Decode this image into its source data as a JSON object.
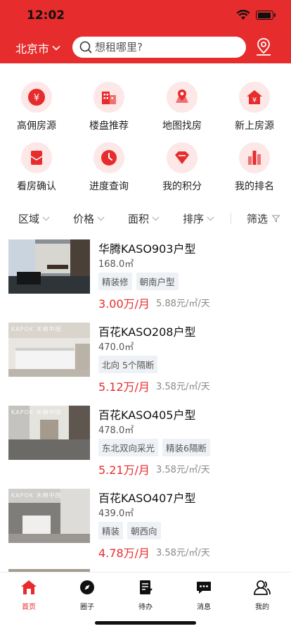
{
  "status": {
    "time": "12:02"
  },
  "header": {
    "city": "北京市",
    "search_placeholder": "想租哪里?"
  },
  "grid": [
    {
      "label": "高佣房源",
      "icon": "yuan-coin-icon"
    },
    {
      "label": "楼盘推荐",
      "icon": "buildings-icon"
    },
    {
      "label": "地图找房",
      "icon": "map-pin-icon"
    },
    {
      "label": "新上房源",
      "icon": "house-yuan-icon"
    },
    {
      "label": "看房确认",
      "icon": "envelope-icon"
    },
    {
      "label": "进度查询",
      "icon": "clock-icon"
    },
    {
      "label": "我的积分",
      "icon": "diamond-icon"
    },
    {
      "label": "我的排名",
      "icon": "bar-chart-icon"
    }
  ],
  "filters": [
    "区域",
    "价格",
    "面积",
    "排序",
    "筛选"
  ],
  "listings": [
    {
      "title": "华腾KASO903户型",
      "area": "168.0㎡",
      "tags": [
        "精装修",
        "朝南户型"
      ],
      "price": "3.00万/月",
      "unit": "5.88元/㎡/天",
      "brand": ""
    },
    {
      "title": "百花KASO208户型",
      "area": "470.0㎡",
      "tags": [
        "北向 5个隔断"
      ],
      "price": "5.12万/月",
      "unit": "3.58元/㎡/天",
      "brand": "KAPOK 木棉中国"
    },
    {
      "title": "百花KASO405户型",
      "area": "478.0㎡",
      "tags": [
        "东北双向采光",
        "精装6隔断"
      ],
      "price": "5.21万/月",
      "unit": "3.58元/㎡/天",
      "brand": "KAPOK 木棉中国"
    },
    {
      "title": "百花KASO407户型",
      "area": "439.0㎡",
      "tags": [
        "精装",
        "朝西向"
      ],
      "price": "4.78万/月",
      "unit": "3.58元/㎡/天",
      "brand": "KAPOK 木棉中国"
    }
  ],
  "tabs": [
    {
      "label": "首页",
      "icon": "home-icon"
    },
    {
      "label": "圈子",
      "icon": "compass-icon"
    },
    {
      "label": "待办",
      "icon": "todo-icon"
    },
    {
      "label": "消息",
      "icon": "message-icon"
    },
    {
      "label": "我的",
      "icon": "user-icon"
    }
  ],
  "colors": {
    "brand": "#e62c2c",
    "icon_bg": "#fde7e7"
  }
}
